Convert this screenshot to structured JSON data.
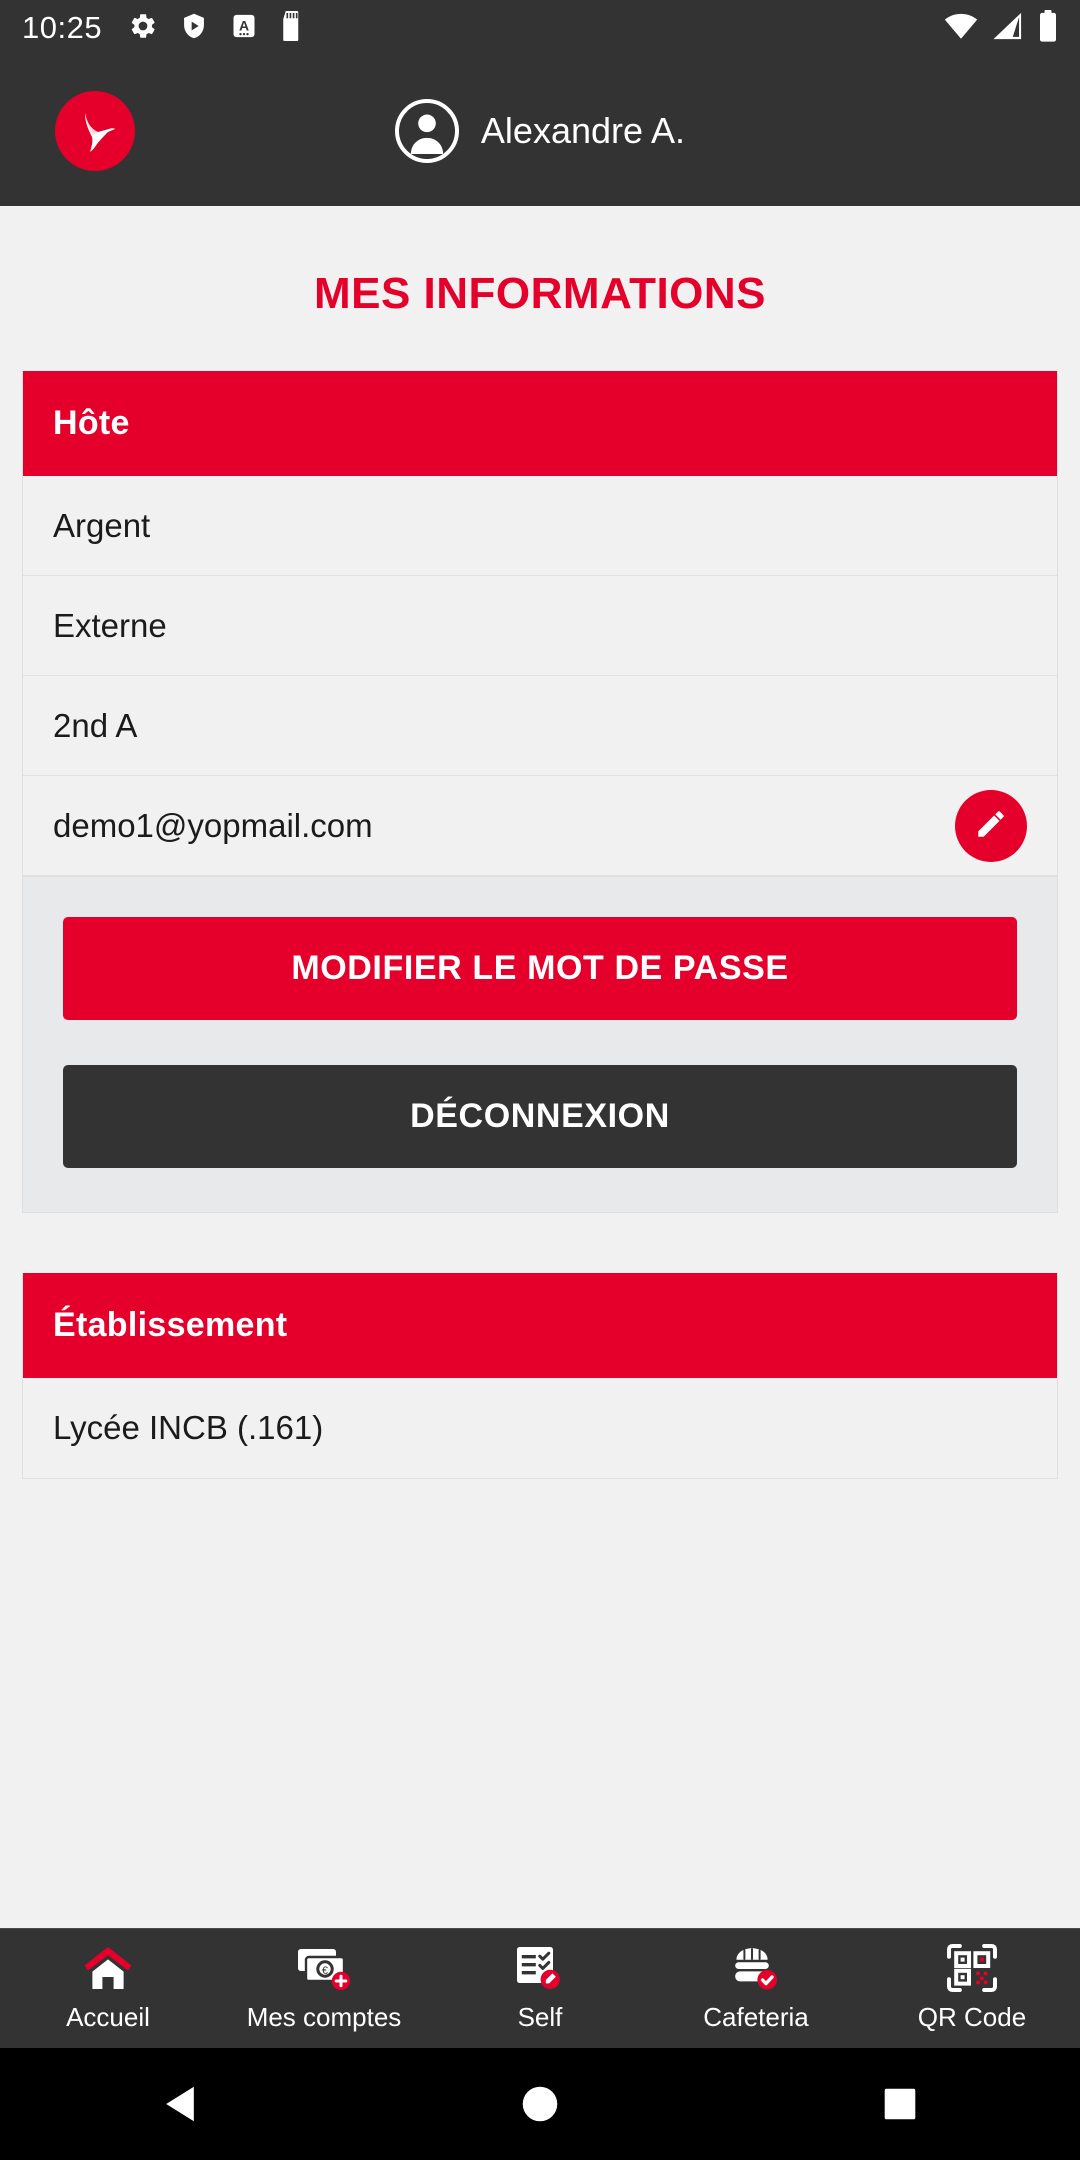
{
  "status_bar": {
    "time": "10:25",
    "left_icons": [
      "gear-icon",
      "play-protect-icon",
      "android-auto-icon",
      "sd-card-icon"
    ],
    "right_icons": [
      "wifi-icon",
      "signal-icon",
      "battery-icon"
    ]
  },
  "app_header": {
    "logo": "hummingbird-logo",
    "avatar": "user-avatar-icon",
    "user_name": "Alexandre A.",
    "background": "#333333"
  },
  "page": {
    "title": "MES INFORMATIONS",
    "title_color": "#e4002b"
  },
  "host_card": {
    "header": "Hôte",
    "rows": [
      {
        "text": "Argent",
        "has_edit": false
      },
      {
        "text": "Externe",
        "has_edit": false
      },
      {
        "text": "2nd A",
        "has_edit": false
      },
      {
        "text": "demo1@yopmail.com",
        "has_edit": true,
        "edit_icon": "pencil-icon"
      }
    ],
    "buttons": {
      "change_password": "MODIFIER LE MOT DE PASSE",
      "logout": "DÉCONNEXION"
    }
  },
  "establishment_card": {
    "header": "Établissement",
    "rows": [
      {
        "text": "Lycée INCB (.161)"
      }
    ]
  },
  "bottom_nav": {
    "items": [
      {
        "label": "Accueil",
        "icon": "home-icon",
        "active": true
      },
      {
        "label": "Mes comptes",
        "icon": "money-add-icon",
        "active": false
      },
      {
        "label": "Self",
        "icon": "list-edit-icon",
        "active": false
      },
      {
        "label": "Cafeteria",
        "icon": "burger-check-icon",
        "active": false
      },
      {
        "label": "QR Code",
        "icon": "qr-code-icon",
        "active": false
      }
    ]
  },
  "system_nav": {
    "buttons": [
      "back-icon",
      "home-icon",
      "recents-icon"
    ]
  },
  "colors": {
    "brand_red": "#e4002b",
    "dark": "#333333",
    "page_bg": "#f1f1f1",
    "actions_bg": "#e8e9ea"
  }
}
